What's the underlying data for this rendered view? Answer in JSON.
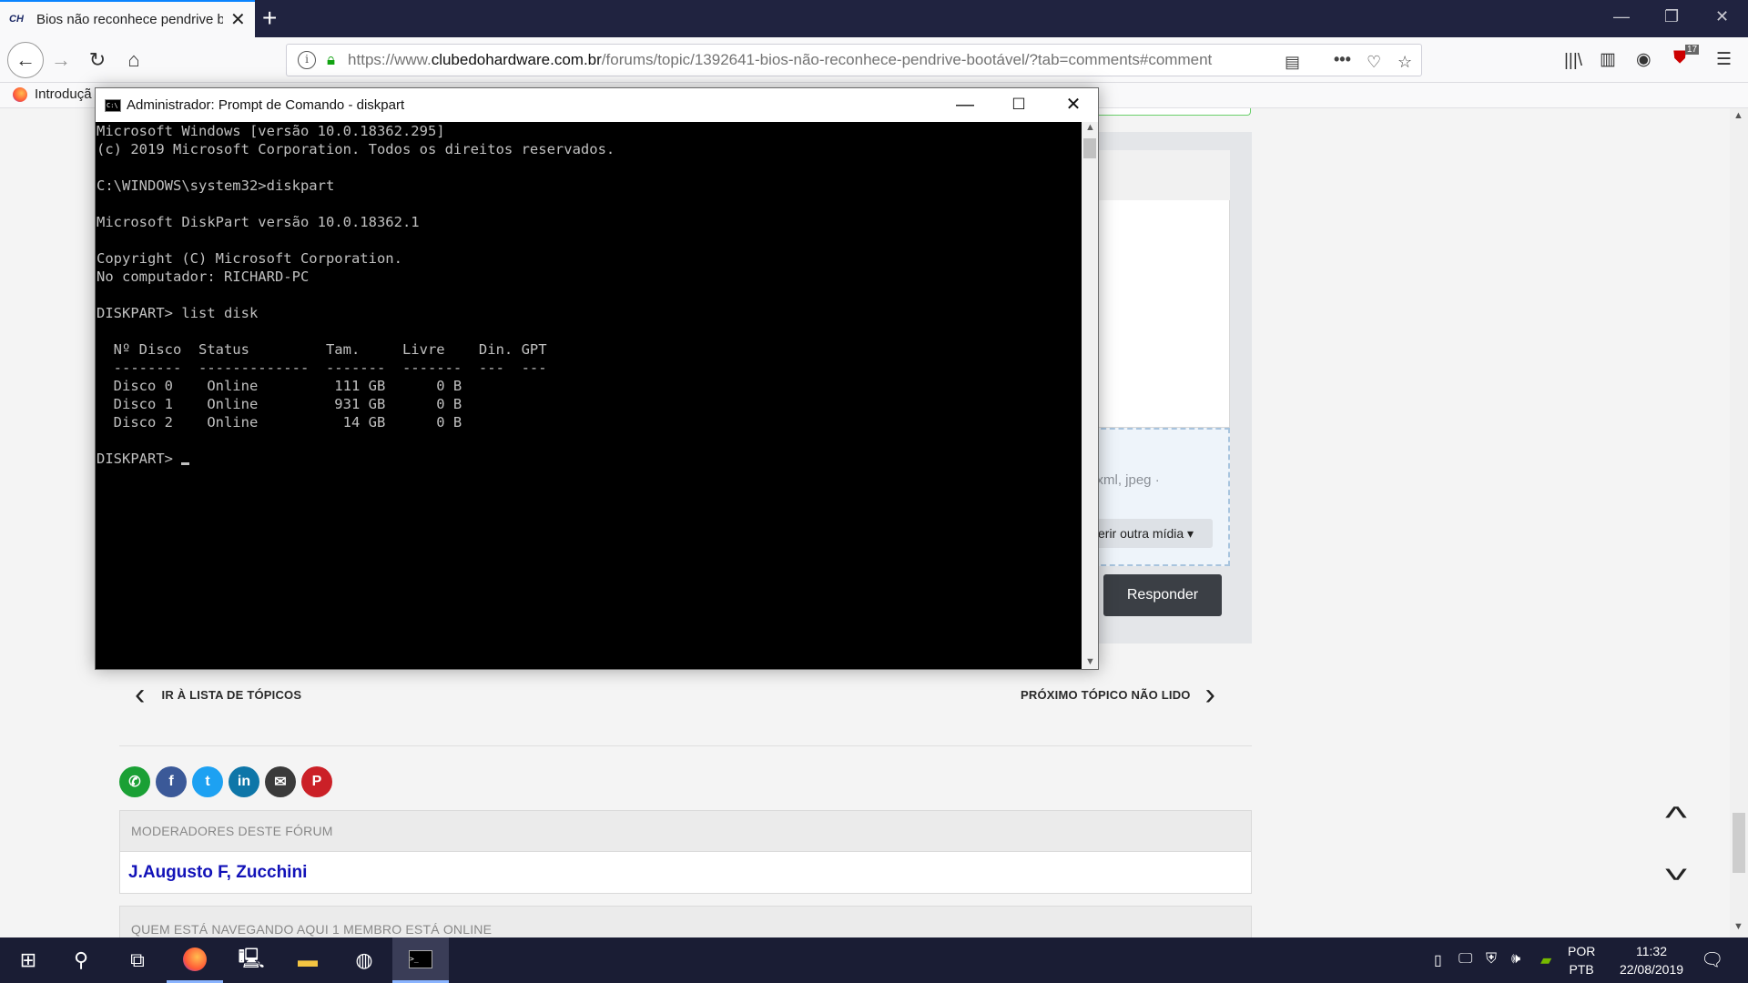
{
  "browser": {
    "tab_title": "Bios não reconhece pendrive b",
    "tab_favicon": "CH",
    "tab_close": "✕",
    "new_tab": "+",
    "url_prefix": "https://www.",
    "url_domain": "clubedohardware.com.br",
    "url_path": "/forums/topic/1392641-bios-não-reconhece-pendrive-bootável/?tab=comments#comment",
    "bookmark": "Introduçã",
    "addon_badge": "17"
  },
  "page": {
    "drop_text": "f, xml, jpeg ·",
    "media_button": "erir outra mídia ▾",
    "reply_button": "Responder",
    "prev_link": "IR À LISTA DE TÓPICOS",
    "next_link": "PRÓXIMO TÓPICO NÃO LIDO",
    "moderators_header": "MODERADORES DESTE FÓRUM",
    "moderator_1": "J.Augusto F",
    "moderator_sep": ", ",
    "moderator_2": "Zucchini",
    "online_header": "QUEM ESTÁ NAVEGANDO AQUI   1 MEMBRO ESTÁ ONLINE",
    "share_colors": {
      "whatsapp": "#1aa035",
      "facebook": "#3b5998",
      "twitter": "#1da1f2",
      "linkedin": "#0e76a8",
      "email": "#3a3a3a",
      "pinterest": "#cb2027"
    }
  },
  "cmd": {
    "title": "Administrador: Prompt de Comando - diskpart",
    "lines": [
      "Microsoft Windows [versão 10.0.18362.295]",
      "(c) 2019 Microsoft Corporation. Todos os direitos reservados.",
      "",
      "C:\\WINDOWS\\system32>diskpart",
      "",
      "Microsoft DiskPart versão 10.0.18362.1",
      "",
      "Copyright (C) Microsoft Corporation.",
      "No computador: RICHARD-PC",
      "",
      "DISKPART> list disk",
      "",
      "  Nº Disco  Status         Tam.     Livre    Din. GPT",
      "  --------  -------------  -------  -------  ---  ---",
      "  Disco 0    Online         111 GB      0 B",
      "  Disco 1    Online         931 GB      0 B",
      "  Disco 2    Online          14 GB      0 B",
      "",
      "DISKPART> "
    ]
  },
  "taskbar": {
    "lang_1": "POR",
    "lang_2": "PTB",
    "time": "11:32",
    "date": "22/08/2019"
  }
}
